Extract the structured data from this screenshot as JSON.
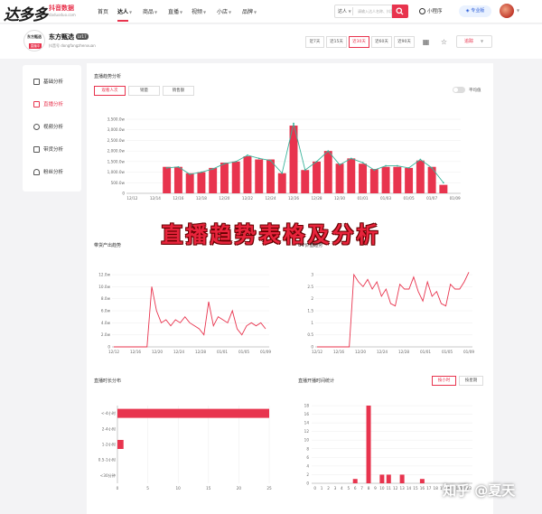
{
  "topbar": {
    "logo": "达多多",
    "logo_sub": "抖音数据",
    "logo_url": "daduoduo.com",
    "nav": [
      {
        "label": "首页",
        "dropdown": false
      },
      {
        "label": "达人",
        "dropdown": true
      },
      {
        "label": "商品",
        "dropdown": true
      },
      {
        "label": "直播",
        "dropdown": true
      },
      {
        "label": "视频",
        "dropdown": true
      },
      {
        "label": "小店",
        "dropdown": true
      },
      {
        "label": "品牌",
        "dropdown": true
      }
    ],
    "search_category": "达人",
    "search_placeholder": "请输入达人名称、抖音号",
    "mini_program": "小程序",
    "plan": "专业版"
  },
  "account": {
    "name": "东方甄选",
    "level": "LV17",
    "douyin_id": "抖音号 dongfangzhenxuan",
    "avatar_text": "东方甄选",
    "avatar_red": "直播中",
    "ranges": [
      "近7天",
      "近15天",
      "近30天",
      "近60天",
      "近90天"
    ],
    "active_range": "近30天",
    "track_label": "追踪"
  },
  "sidebar": {
    "items": [
      {
        "label": "基础分析",
        "active": false
      },
      {
        "label": "直播分析",
        "active": true
      },
      {
        "label": "视频分析",
        "active": false
      },
      {
        "label": "带货分析",
        "active": false
      },
      {
        "label": "粉丝分析",
        "active": false
      }
    ]
  },
  "trend": {
    "title": "直播趋势分析",
    "tabs": [
      "观看人次",
      "销量",
      "销售额"
    ],
    "active_tab": "观看人次",
    "toggle_label": "平均值"
  },
  "banner": "直播趋势表格及分析",
  "sections": {
    "sales_title": "带货产出趋势",
    "uv_title": "UV价值趋势",
    "duration_title": "直播时长分布",
    "start_title": "直播开播时间统计",
    "start_tabs": [
      "按小时",
      "按星期"
    ]
  },
  "watermark": "知乎 @夏天",
  "chart_data": [
    {
      "type": "bar",
      "title": "直播趋势分析",
      "ylabel": "观看人次",
      "ylim": [
        0,
        3500000
      ],
      "yticks": [
        "0",
        "500.0w",
        "1,000.0w",
        "1,500.0w",
        "2,000.0w",
        "2,500.0w",
        "3,000.0w",
        "3,500.0w"
      ],
      "xticks": [
        "12/12",
        "12/14",
        "12/16",
        "12/18",
        "12/20",
        "12/22",
        "12/24",
        "12/26",
        "12/28",
        "12/30",
        "01/01",
        "01/03",
        "01/05",
        "01/07",
        "01/09"
      ],
      "bars": [
        1250000,
        1250000,
        950000,
        1000000,
        1200000,
        1450000,
        1500000,
        1750000,
        1600000,
        1600000,
        950000,
        3200000,
        1100000,
        1500000,
        2000000,
        1400000,
        1650000,
        1400000,
        1150000,
        1250000,
        1250000,
        1200000,
        1550000,
        1250000,
        400000
      ],
      "bar_start_index": 3,
      "line": [
        1200000,
        1250000,
        900000,
        1000000,
        1150000,
        1400000,
        1500000,
        1800000,
        1650000,
        1550000,
        950000,
        3300000,
        1100000,
        1500000,
        2000000,
        1350000,
        1650000,
        1450000,
        1100000,
        1300000,
        1300000,
        1200000,
        1600000,
        1200000,
        500000
      ],
      "grid": true
    },
    {
      "type": "line",
      "title": "带货产出趋势",
      "ylim": [
        0,
        12
      ],
      "yticks": [
        "0",
        "2.0w",
        "4.0w",
        "6.0w",
        "8.0w",
        "10.0w",
        "12.0w"
      ],
      "xticks": [
        "12/12",
        "12/16",
        "12/20",
        "12/24",
        "12/28",
        "01/01",
        "01/05",
        "01/09"
      ],
      "values": [
        0,
        0,
        0,
        0,
        0,
        0,
        0,
        0,
        10,
        6,
        4,
        4.5,
        3.5,
        4.5,
        4,
        5,
        4,
        3.5,
        3,
        2,
        7.5,
        3.5,
        5,
        4.5,
        4,
        6,
        3,
        2,
        3.5,
        4,
        3.5,
        4,
        3
      ]
    },
    {
      "type": "line",
      "title": "UV价值趋势",
      "ylim": [
        0,
        3
      ],
      "yticks": [
        "0",
        "0.5",
        "1",
        "1.5",
        "2",
        "2.5",
        "3"
      ],
      "xticks": [
        "12/12",
        "12/16",
        "12/20",
        "12/24",
        "12/28",
        "01/01",
        "01/05",
        "01/09"
      ],
      "values": [
        0,
        0,
        0,
        0,
        0,
        0,
        0,
        0,
        3,
        2.7,
        2.5,
        2.8,
        2.4,
        2.7,
        2.1,
        2.4,
        1.8,
        1.7,
        2.6,
        2.4,
        2.4,
        2.9,
        2.3,
        1.9,
        2.7,
        2.1,
        2.3,
        1.8,
        1.7,
        2.6,
        2.4,
        2.4,
        2.7,
        3.1
      ]
    },
    {
      "type": "bar",
      "orientation": "horizontal",
      "title": "直播时长分布",
      "categories": [
        "<-4小时",
        "2-4小时",
        "1-2小时",
        "0.5-1小时",
        "<30分钟"
      ],
      "values": [
        25,
        0,
        1,
        0,
        0
      ],
      "xlim": [
        0,
        25
      ],
      "xticks": [
        "0",
        "5",
        "10",
        "15",
        "20",
        "25"
      ]
    },
    {
      "type": "bar",
      "title": "直播开播时间统计",
      "categories": [
        "0",
        "1",
        "2",
        "3",
        "4",
        "5",
        "6",
        "7",
        "8",
        "9",
        "10",
        "11",
        "12",
        "13",
        "14",
        "15",
        "16",
        "17",
        "18",
        "19",
        "20",
        "21",
        "22",
        "23"
      ],
      "values": [
        0,
        0,
        0,
        0,
        0,
        0,
        1,
        0,
        18,
        0,
        2,
        2,
        0,
        2,
        0,
        0,
        1,
        0,
        0,
        0,
        0,
        0,
        0,
        0
      ],
      "ylim": [
        0,
        18
      ],
      "yticks": [
        "0",
        "2",
        "4",
        "6",
        "8",
        "10",
        "12",
        "14",
        "16",
        "18"
      ]
    }
  ]
}
